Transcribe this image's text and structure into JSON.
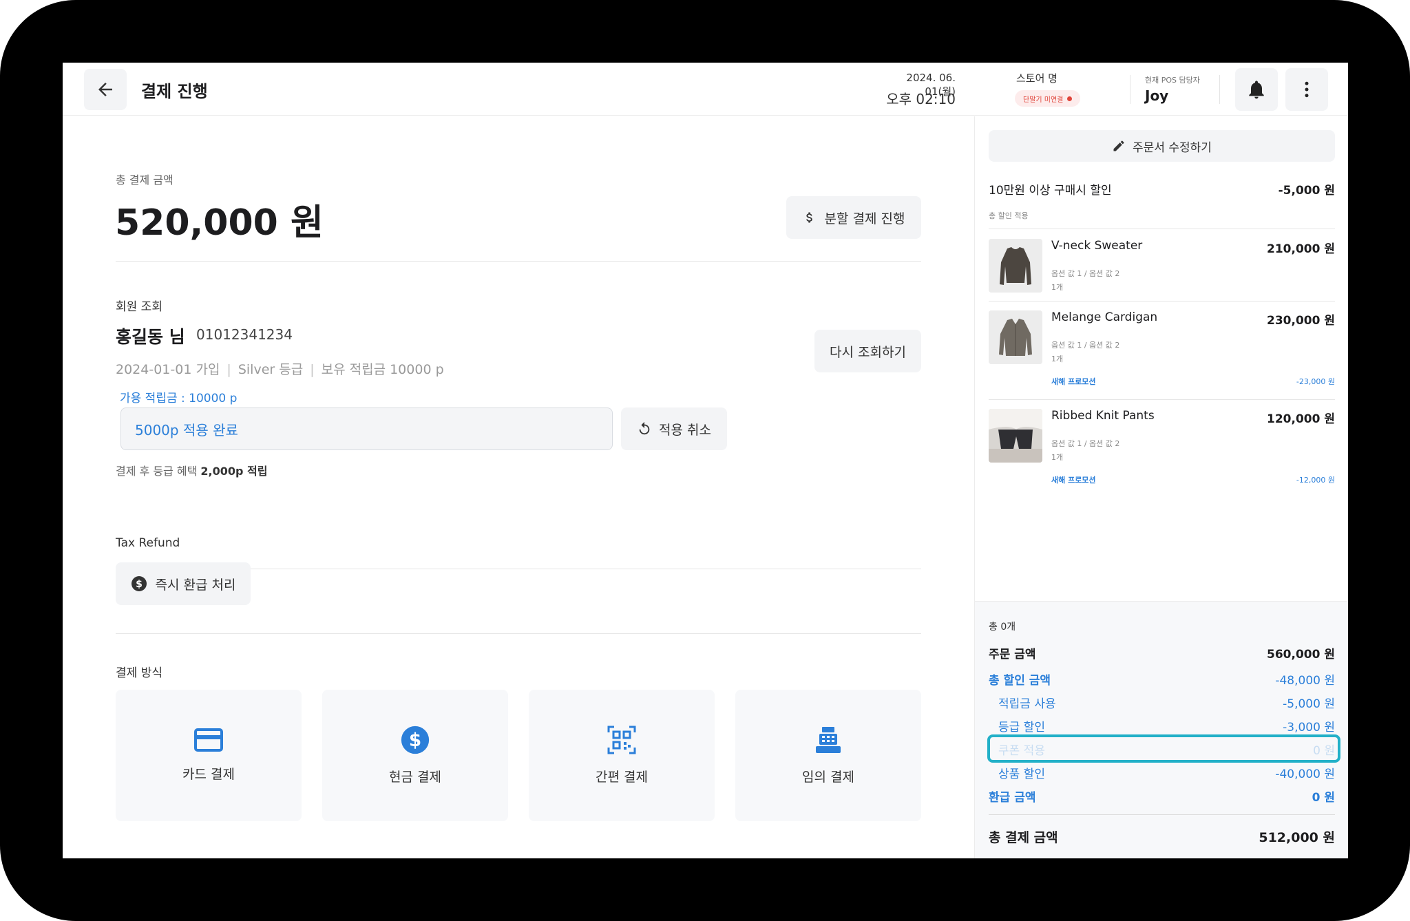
{
  "header": {
    "title": "결제 진행",
    "date": "2024. 06. 01(월)",
    "time": "오후 02:10",
    "store_label": "스토어 명",
    "device_status": "단말기 미연결",
    "staff_label": "현재 POS 담당자",
    "staff_name": "Joy"
  },
  "payment": {
    "total_label": "총 결제 금액",
    "total_amount": "520,000 원",
    "split_button": "분할 결제 진행"
  },
  "member": {
    "section_label": "회원 조회",
    "name": "홍길동 님",
    "phone": "01012341234",
    "joined": "2024-01-01 가입",
    "grade": "Silver 등급",
    "points_held": "보유 적립금 10000 p",
    "requery_button": "다시 조회하기",
    "points_available": "가용 적립금 : 10000 p",
    "points_input_value": "5000p 적용 완료",
    "cancel_apply_button": "적용 취소",
    "grade_benefit_prefix": "결제 후 등급 혜택 ",
    "grade_benefit_value": "2,000p 적립"
  },
  "tax_refund": {
    "label": "Tax Refund",
    "button": "즉시 환급 처리"
  },
  "methods": {
    "label": "결제 방식",
    "items": [
      {
        "label": "카드 결제",
        "icon": "credit-card-icon"
      },
      {
        "label": "현금 결제",
        "icon": "dollar-circle-icon"
      },
      {
        "label": "간편 결제",
        "icon": "qr-code-icon"
      },
      {
        "label": "임의 결제",
        "icon": "cash-register-icon"
      }
    ]
  },
  "order": {
    "edit_button": "주문서 수정하기",
    "promo_label": "10만원 이상 구매시 할인",
    "promo_value": "-5,000 원",
    "promo_sub": "총 할인 적용",
    "items": [
      {
        "name": "V-neck Sweater",
        "price": "210,000 원",
        "options": "옵션 값 1 / 옵션 값 2",
        "qty": "1개",
        "promo": "",
        "promo_value": ""
      },
      {
        "name": "Melange Cardigan",
        "price": "230,000 원",
        "options": "옵션 값 1 / 옵션 값 2",
        "qty": "1개",
        "promo": "새해 프로모션",
        "promo_value": "-23,000 원"
      },
      {
        "name": "Ribbed Knit Pants",
        "price": "120,000 원",
        "options": "옵션 값 1 / 옵션 값 2",
        "qty": "1개",
        "promo": "새해 프로모션",
        "promo_value": "-12,000 원"
      }
    ]
  },
  "summary": {
    "count": "총 0개",
    "order_amount_label": "주문 금액",
    "order_amount": "560,000 원",
    "discount_label": "총 할인 금액",
    "discount": "-48,000 원",
    "points_used_label": "적립금 사용",
    "points_used": "-5,000 원",
    "grade_discount_label": "등급 할인",
    "grade_discount": "-3,000 원",
    "coupon_label": "쿠폰 적용",
    "coupon": "0 원",
    "product_discount_label": "상품 할인",
    "product_discount": "-40,000 원",
    "refund_label": "환급 금액",
    "refund": "0 원",
    "total_label": "총 결제 금액",
    "total": "512,000 원"
  },
  "colors": {
    "accent": "#2b7fd9",
    "highlight": "#22b0c8",
    "alert": "#e0443a"
  }
}
